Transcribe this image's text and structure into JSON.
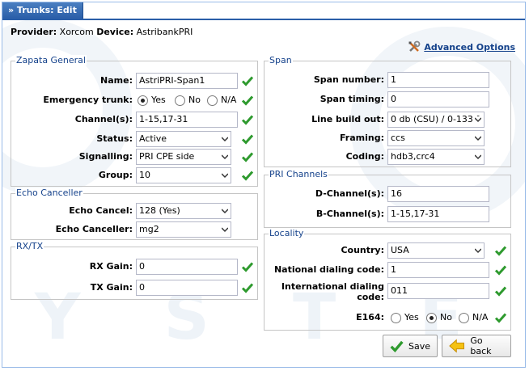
{
  "window": {
    "title": "» Trunks: Edit"
  },
  "provider": {
    "provider_label": "Provider:",
    "provider_value": "Xorcom",
    "device_label": "Device:",
    "device_value": "AstribankPRI"
  },
  "advanced_options": "Advanced Options",
  "background_text": "Y S T E M S",
  "zapata": {
    "legend": "Zapata General",
    "name_label": "Name:",
    "name_value": "AstriPRI-Span1",
    "emergency_label": "Emergency trunk:",
    "emergency_options": [
      "Yes",
      "No",
      "N/A"
    ],
    "emergency_selected": "Yes",
    "channels_label": "Channel(s):",
    "channels_value": "1-15,17-31",
    "status_label": "Status:",
    "status_value": "Active",
    "signalling_label": "Signalling:",
    "signalling_value": "PRI CPE side",
    "group_label": "Group:",
    "group_value": "10"
  },
  "echo": {
    "legend": "Echo Canceller",
    "cancel_label": "Echo Cancel:",
    "cancel_value": "128 (Yes)",
    "canceller_label": "Echo Canceller:",
    "canceller_value": "mg2"
  },
  "rxtx": {
    "legend": "RX/TX",
    "rx_label": "RX Gain:",
    "rx_value": "0",
    "tx_label": "TX Gain:",
    "tx_value": "0"
  },
  "span": {
    "legend": "Span",
    "number_label": "Span number:",
    "number_value": "1",
    "timing_label": "Span timing:",
    "timing_value": "0",
    "buildout_label": "Line build out:",
    "buildout_value": "0 db (CSU) / 0-133 f",
    "framing_label": "Framing:",
    "framing_value": "ccs",
    "coding_label": "Coding:",
    "coding_value": "hdb3,crc4"
  },
  "pri": {
    "legend": "PRI Channels",
    "d_label": "D-Channel(s):",
    "d_value": "16",
    "b_label": "B-Channel(s):",
    "b_value": "1-15,17-31"
  },
  "locality": {
    "legend": "Locality",
    "country_label": "Country:",
    "country_value": "USA",
    "national_label": "National dialing code:",
    "national_value": "1",
    "international_label_1": "International dialing",
    "international_label_2": "code:",
    "international_value": "011",
    "e164_label": "E164:",
    "e164_options": [
      "Yes",
      "No",
      "N/A"
    ],
    "e164_selected": "No"
  },
  "buttons": {
    "save": "Save",
    "back": "Go back"
  },
  "colors": {
    "accent": "#15428b",
    "title_bg": "#2a5ea8",
    "check": "#2e9a2e"
  }
}
